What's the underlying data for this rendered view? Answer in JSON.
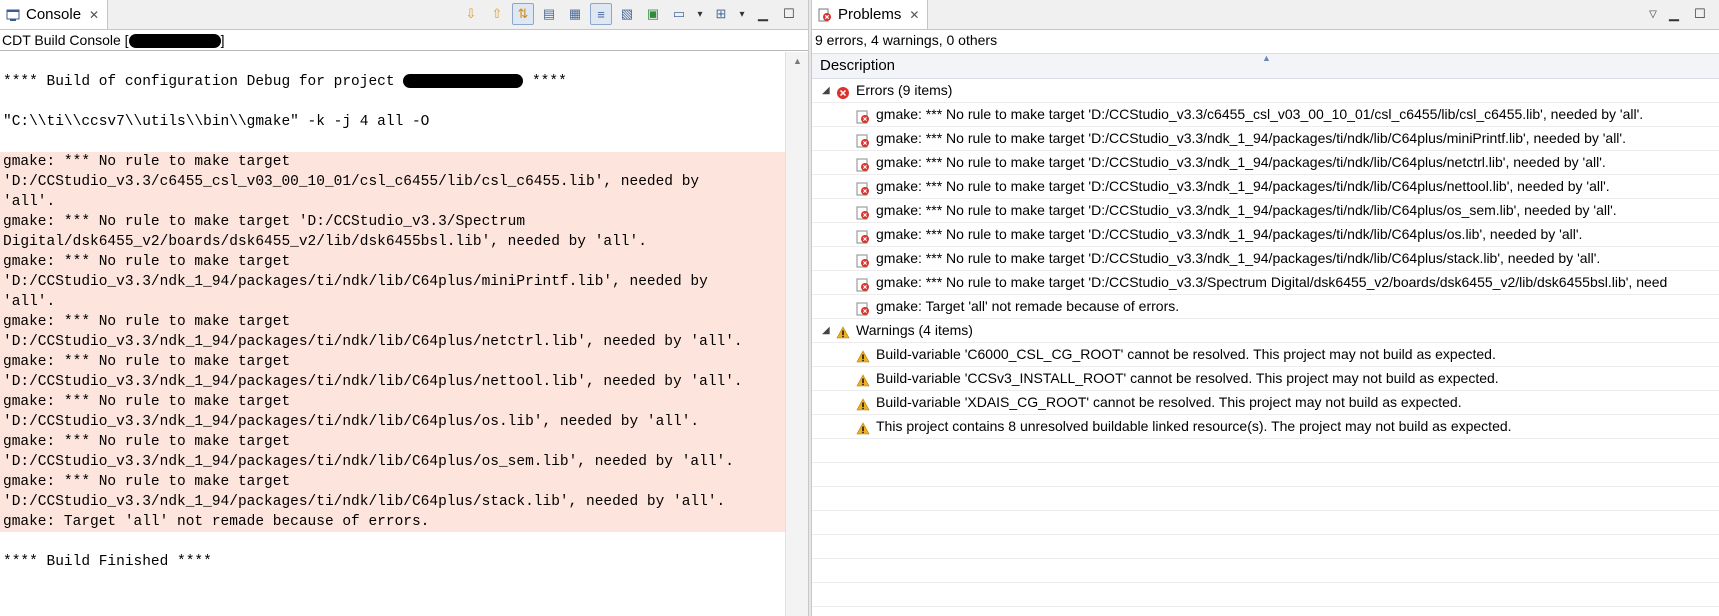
{
  "console": {
    "tab_label": "Console",
    "header_prefix": "CDT Build Console [",
    "header_suffix": "]",
    "lines": [
      {
        "text": "",
        "error": false
      },
      {
        "text": "**** Build of configuration Debug for project ",
        "error": false,
        "redact_after": true,
        "tail": " ****"
      },
      {
        "text": "",
        "error": false
      },
      {
        "text": "\"C:\\\\ti\\\\ccsv7\\\\utils\\\\bin\\\\gmake\" -k -j 4 all -O",
        "error": false
      },
      {
        "text": "",
        "error": false
      },
      {
        "text": "gmake: *** No rule to make target",
        "error": true
      },
      {
        "text": "'D:/CCStudio_v3.3/c6455_csl_v03_00_10_01/csl_c6455/lib/csl_c6455.lib', needed by",
        "error": true
      },
      {
        "text": "'all'.",
        "error": true
      },
      {
        "text": "gmake: *** No rule to make target 'D:/CCStudio_v3.3/Spectrum",
        "error": true
      },
      {
        "text": "Digital/dsk6455_v2/boards/dsk6455_v2/lib/dsk6455bsl.lib', needed by 'all'.",
        "error": true
      },
      {
        "text": "gmake: *** No rule to make target",
        "error": true
      },
      {
        "text": "'D:/CCStudio_v3.3/ndk_1_94/packages/ti/ndk/lib/C64plus/miniPrintf.lib', needed by",
        "error": true
      },
      {
        "text": "'all'.",
        "error": true
      },
      {
        "text": "gmake: *** No rule to make target",
        "error": true
      },
      {
        "text": "'D:/CCStudio_v3.3/ndk_1_94/packages/ti/ndk/lib/C64plus/netctrl.lib', needed by 'all'.",
        "error": true
      },
      {
        "text": "gmake: *** No rule to make target",
        "error": true
      },
      {
        "text": "'D:/CCStudio_v3.3/ndk_1_94/packages/ti/ndk/lib/C64plus/nettool.lib', needed by 'all'.",
        "error": true
      },
      {
        "text": "gmake: *** No rule to make target",
        "error": true
      },
      {
        "text": "'D:/CCStudio_v3.3/ndk_1_94/packages/ti/ndk/lib/C64plus/os.lib', needed by 'all'.",
        "error": true
      },
      {
        "text": "gmake: *** No rule to make target",
        "error": true
      },
      {
        "text": "'D:/CCStudio_v3.3/ndk_1_94/packages/ti/ndk/lib/C64plus/os_sem.lib', needed by 'all'.",
        "error": true
      },
      {
        "text": "gmake: *** No rule to make target",
        "error": true
      },
      {
        "text": "'D:/CCStudio_v3.3/ndk_1_94/packages/ti/ndk/lib/C64plus/stack.lib', needed by 'all'.",
        "error": true
      },
      {
        "text": "gmake: Target 'all' not remade because of errors.",
        "error": true
      },
      {
        "text": "",
        "error": false
      },
      {
        "text": "**** Build Finished ****",
        "error": false
      }
    ]
  },
  "problems": {
    "tab_label": "Problems",
    "summary": "9 errors, 4 warnings, 0 others",
    "column_description": "Description",
    "groups": [
      {
        "label": "Errors (9 items)",
        "kind": "error",
        "items": [
          "gmake: *** No rule to make target 'D:/CCStudio_v3.3/c6455_csl_v03_00_10_01/csl_c6455/lib/csl_c6455.lib', needed by 'all'.",
          "gmake: *** No rule to make target 'D:/CCStudio_v3.3/ndk_1_94/packages/ti/ndk/lib/C64plus/miniPrintf.lib', needed by 'all'.",
          "gmake: *** No rule to make target 'D:/CCStudio_v3.3/ndk_1_94/packages/ti/ndk/lib/C64plus/netctrl.lib', needed by 'all'.",
          "gmake: *** No rule to make target 'D:/CCStudio_v3.3/ndk_1_94/packages/ti/ndk/lib/C64plus/nettool.lib', needed by 'all'.",
          "gmake: *** No rule to make target 'D:/CCStudio_v3.3/ndk_1_94/packages/ti/ndk/lib/C64plus/os_sem.lib', needed by 'all'.",
          "gmake: *** No rule to make target 'D:/CCStudio_v3.3/ndk_1_94/packages/ti/ndk/lib/C64plus/os.lib', needed by 'all'.",
          "gmake: *** No rule to make target 'D:/CCStudio_v3.3/ndk_1_94/packages/ti/ndk/lib/C64plus/stack.lib', needed by 'all'.",
          "gmake: *** No rule to make target 'D:/CCStudio_v3.3/Spectrum Digital/dsk6455_v2/boards/dsk6455_v2/lib/dsk6455bsl.lib', need",
          "gmake: Target 'all' not remade because of errors."
        ]
      },
      {
        "label": "Warnings (4 items)",
        "kind": "warning",
        "items": [
          "Build-variable 'C6000_CSL_CG_ROOT' cannot be resolved. This project may not build as expected.",
          "Build-variable 'CCSv3_INSTALL_ROOT' cannot be resolved. This project may not build as expected.",
          "Build-variable 'XDAIS_CG_ROOT' cannot be resolved. This project may not build as expected.",
          "This project contains 8 unresolved buildable linked resource(s). The project may not build as expected."
        ]
      }
    ]
  },
  "colors": {
    "error_bg": "#fde4dc",
    "error_icon": "#d9332c",
    "warning_icon": "#f2b01e"
  },
  "icons": {
    "console_tab": "console-icon",
    "problems_tab": "problems-icon",
    "toolbar": [
      "scroll-down-icon",
      "scroll-up-icon",
      "scroll-lock-icon",
      "clear-console-icon",
      "word-wrap-icon",
      "show-console-icon",
      "pin-console-icon",
      "display-console-icon",
      "new-console-icon"
    ]
  }
}
